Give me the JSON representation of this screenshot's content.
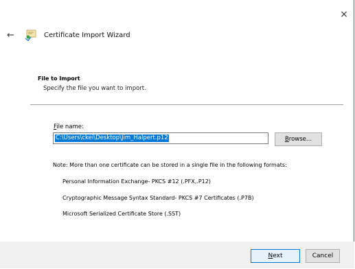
{
  "window": {
    "close_glyph": "×",
    "back_glyph": "←",
    "title": "Certificate Import Wizard",
    "icon": "certificate-import-icon"
  },
  "section": {
    "title": "File to Import",
    "description": "Specify the file you want to import."
  },
  "file_name": {
    "label_accel": "F",
    "label_rest": "ile name:",
    "value": "C:\\Users\\ckei\\Desktop\\Jim_Halpert.p12",
    "browse_accel": "B",
    "browse_rest": "rowse..."
  },
  "note": "Note:  More than one certificate can be stored in a single file in the following formats:",
  "formats": [
    "Personal Information Exchange- PKCS #12 (.PFX,.P12)",
    "Cryptographic Message Syntax Standard- PKCS #7 Certificates (.P7B)",
    "Microsoft Serialized Certificate Store (.SST)"
  ],
  "buttons": {
    "next_accel": "N",
    "next_rest": "ext",
    "cancel": "Cancel"
  },
  "colors": {
    "accent": "#0078d7",
    "border": "#1e6fbf"
  }
}
